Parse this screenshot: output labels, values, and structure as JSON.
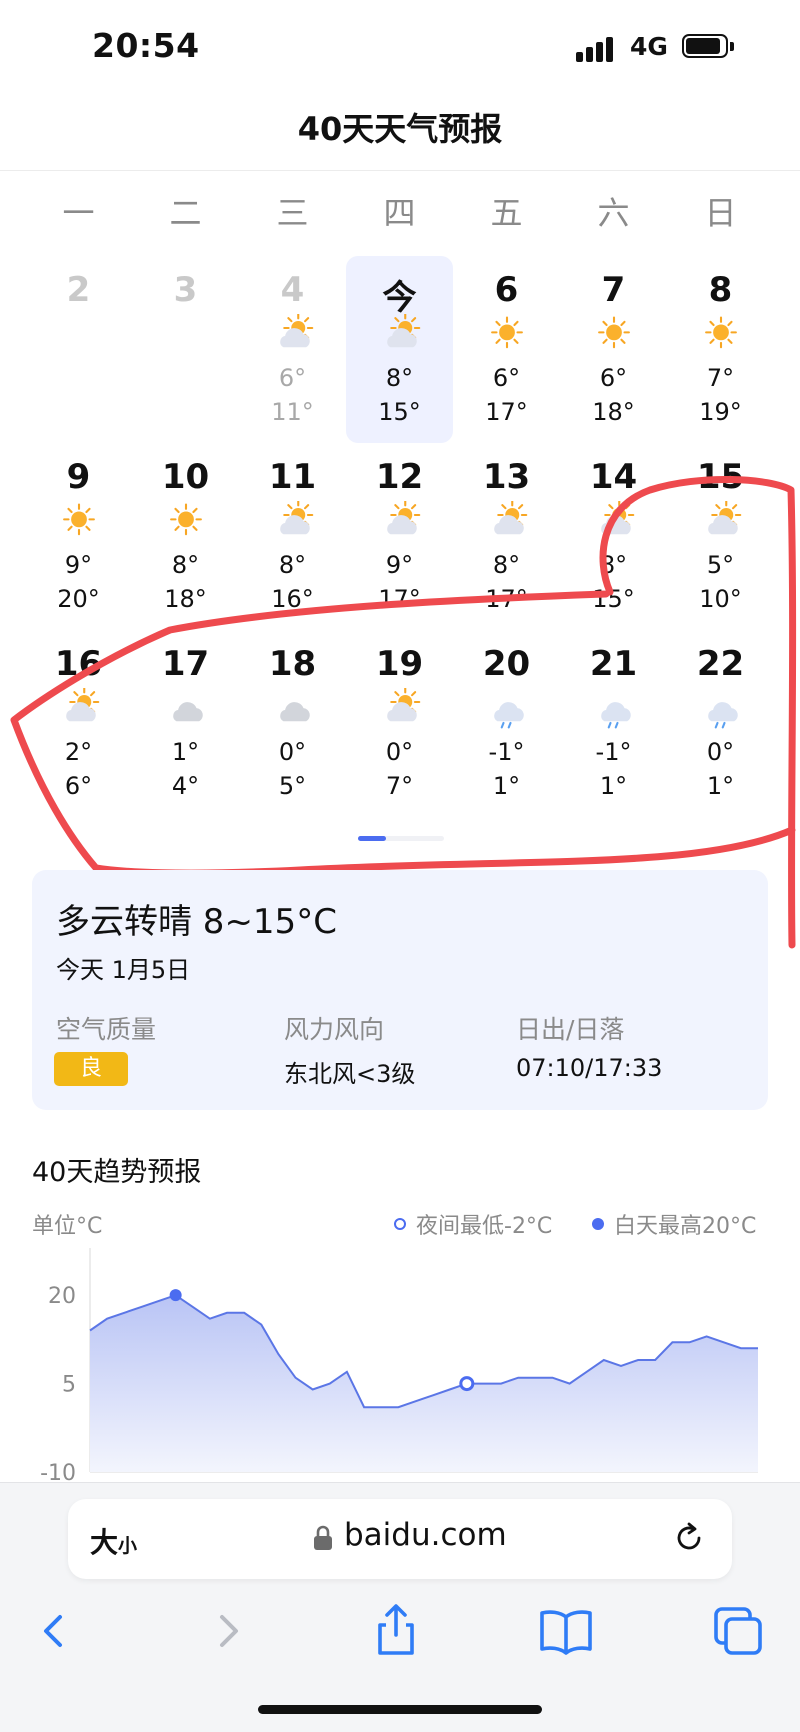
{
  "status": {
    "time": "20:54",
    "network": "4G"
  },
  "header": {
    "title": "40天天气预报"
  },
  "weekdays": [
    "一",
    "二",
    "三",
    "四",
    "五",
    "六",
    "日"
  ],
  "calendar": {
    "rows": [
      [
        {
          "day": "2",
          "icon": "",
          "lo": "",
          "hi": "",
          "state": "past"
        },
        {
          "day": "3",
          "icon": "",
          "lo": "",
          "hi": "",
          "state": "past"
        },
        {
          "day": "4",
          "icon": "partly-cloudy-icon",
          "lo": "6°",
          "hi": "11°",
          "state": "past"
        },
        {
          "day": "今",
          "icon": "partly-cloudy-icon",
          "lo": "8°",
          "hi": "15°",
          "state": "today"
        },
        {
          "day": "6",
          "icon": "sunny-icon",
          "lo": "6°",
          "hi": "17°",
          "state": "future"
        },
        {
          "day": "7",
          "icon": "sunny-icon",
          "lo": "6°",
          "hi": "18°",
          "state": "future"
        },
        {
          "day": "8",
          "icon": "sunny-icon",
          "lo": "7°",
          "hi": "19°",
          "state": "future"
        }
      ],
      [
        {
          "day": "9",
          "icon": "sunny-icon",
          "lo": "9°",
          "hi": "20°",
          "state": "future"
        },
        {
          "day": "10",
          "icon": "sunny-icon",
          "lo": "8°",
          "hi": "18°",
          "state": "future"
        },
        {
          "day": "11",
          "icon": "partly-cloudy-icon",
          "lo": "8°",
          "hi": "16°",
          "state": "future"
        },
        {
          "day": "12",
          "icon": "partly-cloudy-icon",
          "lo": "9°",
          "hi": "17°",
          "state": "future"
        },
        {
          "day": "13",
          "icon": "partly-cloudy-icon",
          "lo": "8°",
          "hi": "17°",
          "state": "future"
        },
        {
          "day": "14",
          "icon": "partly-cloudy-icon",
          "lo": "8°",
          "hi": "15°",
          "state": "future"
        },
        {
          "day": "15",
          "icon": "partly-cloudy-icon",
          "lo": "5°",
          "hi": "10°",
          "state": "future"
        }
      ],
      [
        {
          "day": "16",
          "icon": "partly-cloudy-icon",
          "lo": "2°",
          "hi": "6°",
          "state": "future"
        },
        {
          "day": "17",
          "icon": "cloudy-icon",
          "lo": "1°",
          "hi": "4°",
          "state": "future"
        },
        {
          "day": "18",
          "icon": "cloudy-icon",
          "lo": "0°",
          "hi": "5°",
          "state": "future"
        },
        {
          "day": "19",
          "icon": "partly-cloudy-icon",
          "lo": "0°",
          "hi": "7°",
          "state": "future"
        },
        {
          "day": "20",
          "icon": "rain-icon",
          "lo": "-1°",
          "hi": "1°",
          "state": "future"
        },
        {
          "day": "21",
          "icon": "rain-icon",
          "lo": "-1°",
          "hi": "1°",
          "state": "future"
        },
        {
          "day": "22",
          "icon": "rain-icon",
          "lo": "0°",
          "hi": "1°",
          "state": "future"
        }
      ]
    ]
  },
  "detail": {
    "condition": "多云转晴 8~15°C",
    "date": "今天 1月5日",
    "air_label": "空气质量",
    "air_value": "良",
    "wind_label": "风力风向",
    "wind_value": "东北风<3级",
    "sun_label": "日出/日落",
    "sun_value": "07:10/17:33"
  },
  "trend": {
    "title": "40天趋势预报",
    "unit": "单位°C",
    "legend_low": "夜间最低-2°C",
    "legend_high": "白天最高20°C"
  },
  "colors": {
    "accent": "#4b6cf0",
    "annotation": "#ee4a4e",
    "badge": "#f2b816",
    "sun": "#f7a623"
  },
  "chart_data": {
    "type": "area",
    "ylabel": "单位°C",
    "yticks": [
      20,
      5,
      -10
    ],
    "ylim": [
      -10,
      28
    ],
    "x": [
      1,
      2,
      3,
      4,
      5,
      6,
      7,
      8,
      9,
      10,
      11,
      12,
      13,
      14,
      15,
      16,
      17,
      18,
      19,
      20,
      21,
      22,
      23,
      24,
      25,
      26,
      27,
      28,
      29,
      30,
      31,
      32,
      33,
      34,
      35,
      36,
      37,
      38,
      39,
      40
    ],
    "series": [
      {
        "values": [
          14,
          16,
          17,
          18,
          19,
          20,
          18,
          16,
          17,
          17,
          15,
          10,
          6,
          4,
          5,
          7,
          1,
          1,
          1,
          2,
          3,
          4,
          5,
          5,
          5,
          6,
          6,
          6,
          5,
          7,
          9,
          8,
          9,
          9,
          12,
          12,
          13,
          12,
          11,
          11
        ]
      }
    ],
    "markers": [
      {
        "label": "白天最高20°C",
        "x": 6,
        "y": 20
      },
      {
        "label": "夜间最低-2°C",
        "x": 23,
        "y": 5
      }
    ]
  },
  "browser": {
    "text_size": "大",
    "text_size_small": "小",
    "url": "baidu.com"
  }
}
